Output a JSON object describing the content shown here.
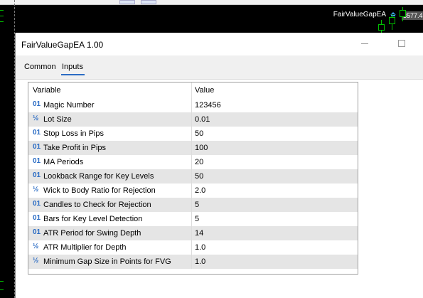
{
  "chart": {
    "label": "FairValueGapEA",
    "price_tag": "3577.4"
  },
  "dialog": {
    "title": "FairValueGapEA 1.00",
    "tabs": [
      {
        "label": "Common",
        "active": false
      },
      {
        "label": "Inputs",
        "active": true
      }
    ],
    "table": {
      "headers": {
        "variable": "Variable",
        "value": "Value"
      },
      "rows": [
        {
          "type": "01",
          "name": "Magic Number",
          "value": "123456"
        },
        {
          "type": "½",
          "name": "Lot Size",
          "value": "0.01"
        },
        {
          "type": "01",
          "name": "Stop Loss in Pips",
          "value": "50"
        },
        {
          "type": "01",
          "name": "Take Profit in Pips",
          "value": "100"
        },
        {
          "type": "01",
          "name": "MA Periods",
          "value": "20"
        },
        {
          "type": "01",
          "name": "Lookback Range for Key Levels",
          "value": "50"
        },
        {
          "type": "½",
          "name": "Wick to Body Ratio for Rejection",
          "value": "2.0"
        },
        {
          "type": "01",
          "name": "Candles to Check for Rejection",
          "value": "5"
        },
        {
          "type": "01",
          "name": "Bars for Key Level Detection",
          "value": "5"
        },
        {
          "type": "01",
          "name": "ATR Period for Swing Depth",
          "value": "14"
        },
        {
          "type": "½",
          "name": "ATR Multiplier for Depth",
          "value": "1.0"
        },
        {
          "type": "½",
          "name": "Minimum Gap Size in Points for FVG",
          "value": "1.0"
        }
      ]
    }
  },
  "colors": {
    "accent": "#2b6cc4",
    "chart_bg": "#000000",
    "candle": "#00c000"
  }
}
